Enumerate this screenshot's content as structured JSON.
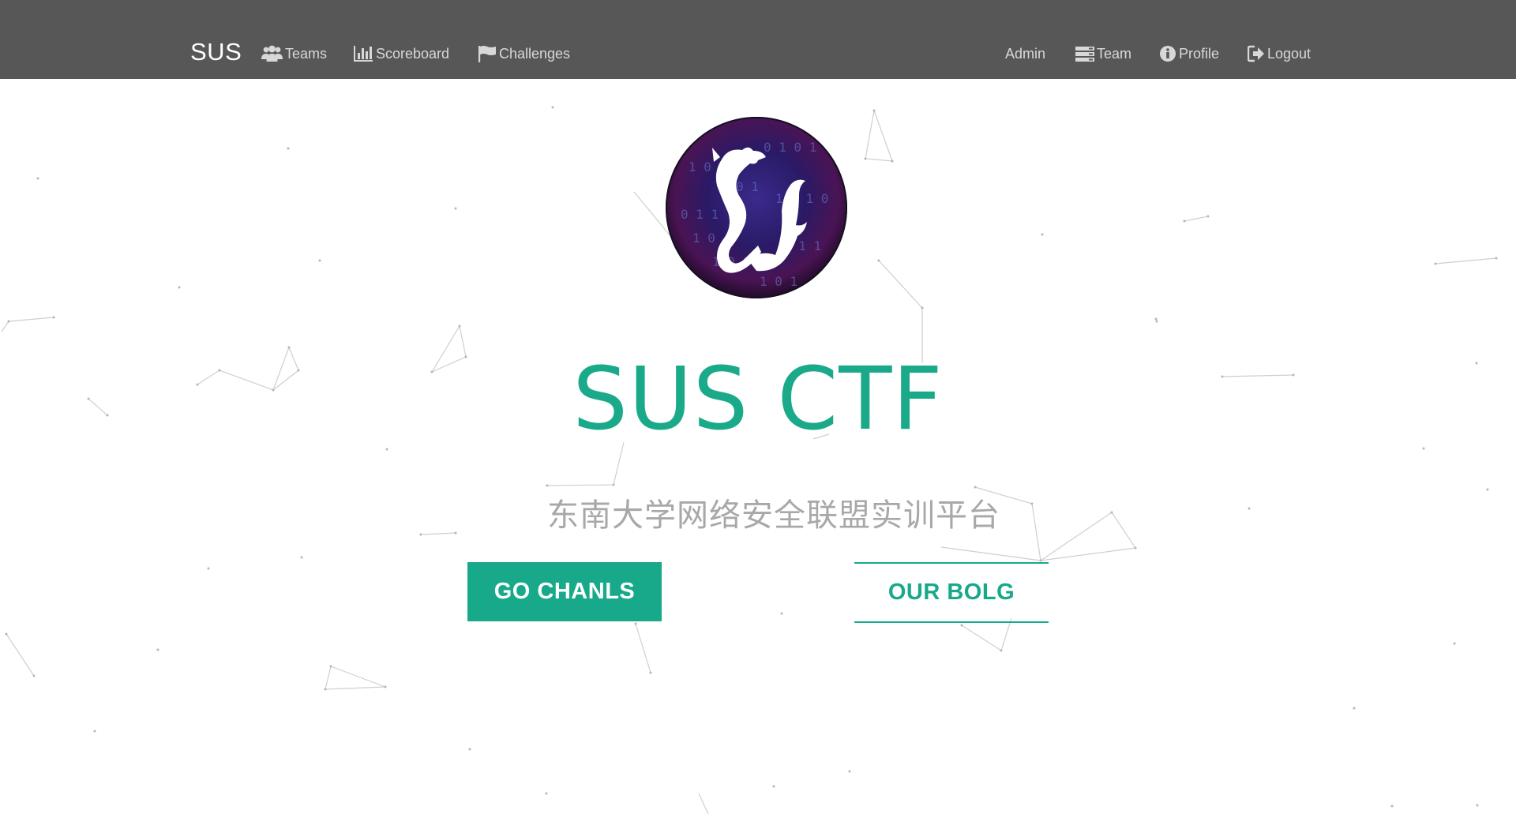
{
  "navbar": {
    "brand": "SUS",
    "left_items": [
      {
        "label": "Teams",
        "icon": "users-icon"
      },
      {
        "label": "Scoreboard",
        "icon": "bar-chart-icon"
      },
      {
        "label": "Challenges",
        "icon": "flag-icon"
      }
    ],
    "right_items": [
      {
        "label": "Admin",
        "icon": ""
      },
      {
        "label": "Team",
        "icon": "server-icon"
      },
      {
        "label": "Profile",
        "icon": "info-circle-icon"
      },
      {
        "label": "Logout",
        "icon": "sign-out-icon"
      }
    ]
  },
  "hero": {
    "logo_icon": "dragon-logo",
    "title": "SUS CTF",
    "subtitle": "东南大学网络安全联盟实训平台",
    "primary_button": "GO CHANLS",
    "secondary_button": "OUR BOLG"
  },
  "colors": {
    "navbar_bg": "#575757",
    "accent": "#1aaa8a",
    "subtitle": "#a8a8a8",
    "nav_text": "#d8d8d8"
  }
}
